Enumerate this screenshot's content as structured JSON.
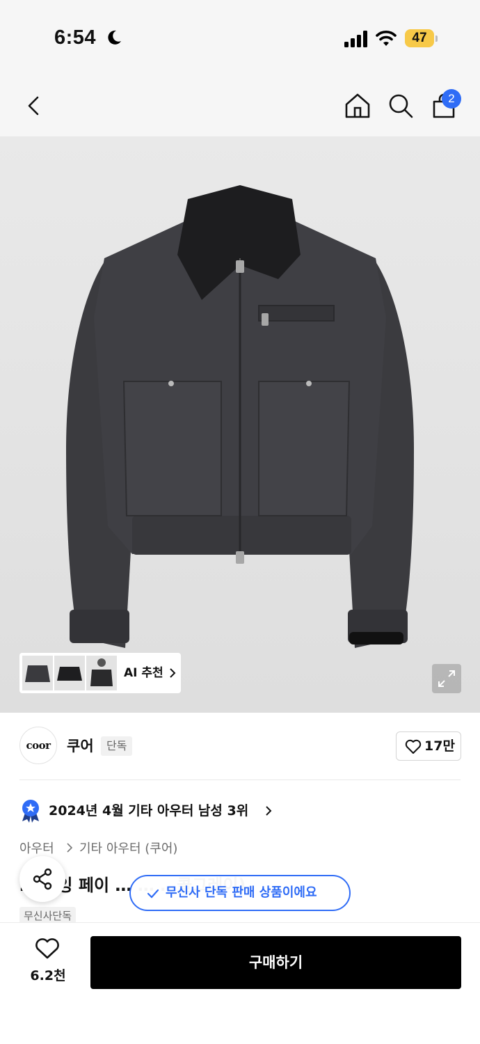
{
  "status_bar": {
    "time": "6:54",
    "battery_level": "47",
    "icons": [
      "moon-icon",
      "signal-icon",
      "wifi-icon",
      "battery-icon"
    ]
  },
  "nav": {
    "icons": [
      "back-icon",
      "home-icon",
      "search-icon",
      "cart-icon"
    ],
    "cart_badge": "2"
  },
  "gallery": {
    "ai_recommend_label": "AI 추천",
    "thumbnail_count": 3
  },
  "brand": {
    "logo_text": "coor",
    "name": "쿠어",
    "exclusive_chip": "단독",
    "like_count": "17만"
  },
  "ranking": {
    "text": "2024년 4월 기타 아우터 남성 3위"
  },
  "breadcrumb": {
    "level1": "아우터",
    "level2": "기타 아우터 (쿠어)"
  },
  "product": {
    "title": "… 다잉 페이 …  …                         …콜그레이)",
    "tag": "무신사단독"
  },
  "toast": {
    "text": "무신사 단독 판매 상품이에요"
  },
  "bottom_bar": {
    "like_count": "6.2천",
    "buy_label": "구매하기"
  },
  "colors": {
    "accent_blue": "#2f6cf6",
    "battery_yellow": "#f7c948",
    "buy_button": "#000000"
  }
}
